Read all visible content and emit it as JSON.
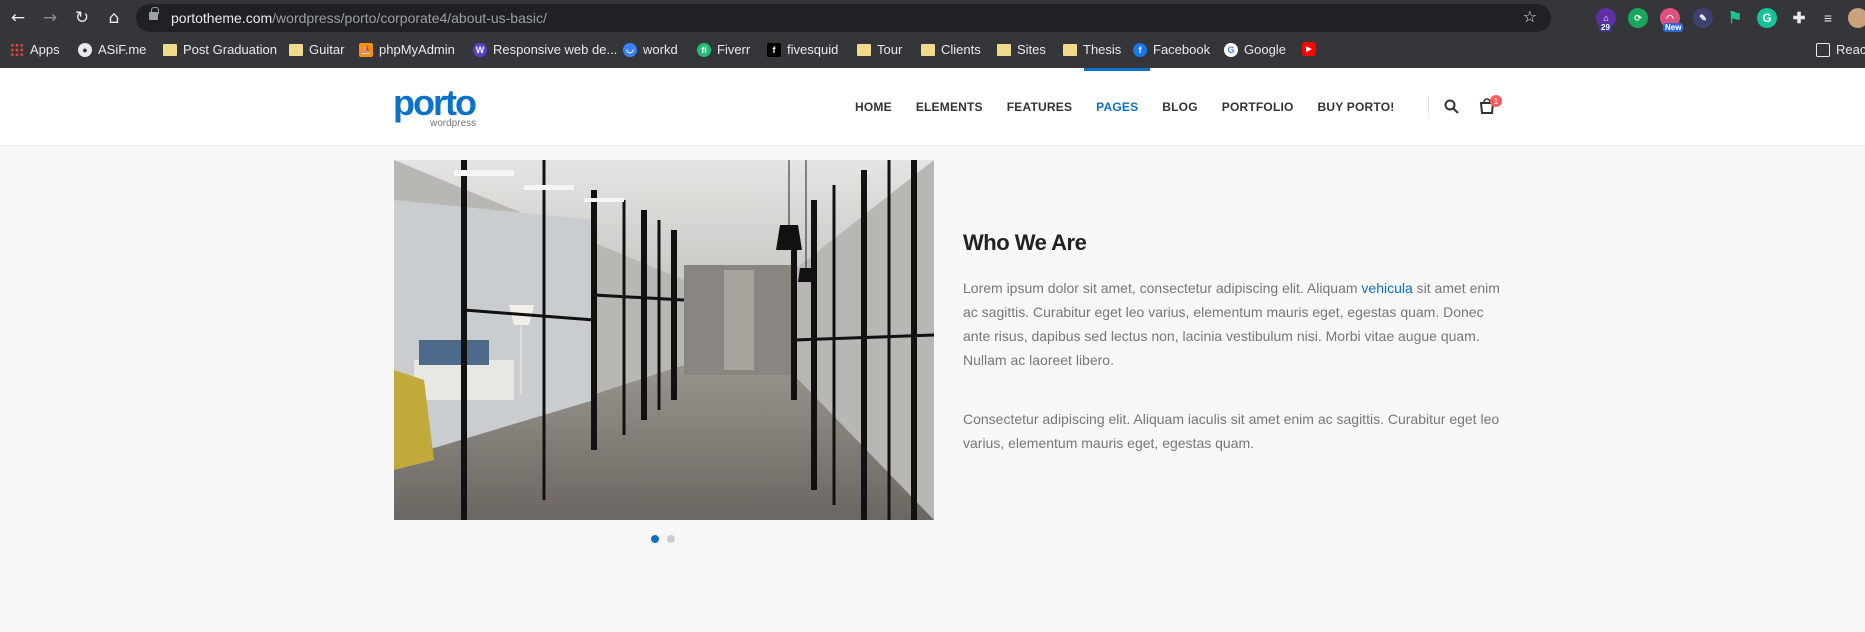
{
  "browser": {
    "url_host": "portotheme.com",
    "url_path": "/wordpress/porto/corporate4/about-us-basic/",
    "extension_badges": {
      "ext1": "29",
      "ext3": "New"
    },
    "bookmarks": [
      {
        "label": "Apps"
      },
      {
        "label": "ASiF.me"
      },
      {
        "label": "Post Graduation"
      },
      {
        "label": "Guitar"
      },
      {
        "label": "phpMyAdmin"
      },
      {
        "label": "Responsive web de..."
      },
      {
        "label": "workd"
      },
      {
        "label": "Fiverr"
      },
      {
        "label": "fivesquid"
      },
      {
        "label": "Tour"
      },
      {
        "label": "Clients"
      },
      {
        "label": "Sites"
      },
      {
        "label": "Thesis"
      },
      {
        "label": "Facebook"
      },
      {
        "label": "Google"
      },
      {
        "label": ""
      }
    ],
    "reading_list_label": "Reac"
  },
  "site": {
    "logo_text": "porto",
    "logo_sub": "wordpress",
    "menu": [
      "HOME",
      "ELEMENTS",
      "FEATURES",
      "PAGES",
      "BLOG",
      "PORTFOLIO",
      "BUY PORTO!"
    ],
    "active_menu": "PAGES",
    "cart_count": "1"
  },
  "content": {
    "heading_light": "Who ",
    "heading_bold": "We Are",
    "para1_a": "Lorem ipsum dolor sit amet, consectetur adipiscing elit. Aliquam ",
    "para1_link": "vehicula",
    "para1_b": " sit amet enim ac sagittis. Curabitur eget leo varius, elementum mauris eget, egestas quam. Donec ante risus, dapibus sed lectus non, lacinia vestibulum nisi. Morbi vitae augue quam. Nullam ac laoreet libero.",
    "para2": "Consectetur adipiscing elit. Aliquam iaculis sit amet enim ac sagittis. Curabitur eget leo varius, elementum mauris eget, egestas quam.",
    "carousel_active_index": 1,
    "carousel_count": 2
  },
  "colors": {
    "accent": "#0a72c8",
    "chrome_bg": "#35363a",
    "page_bg": "#f7f7f7"
  }
}
